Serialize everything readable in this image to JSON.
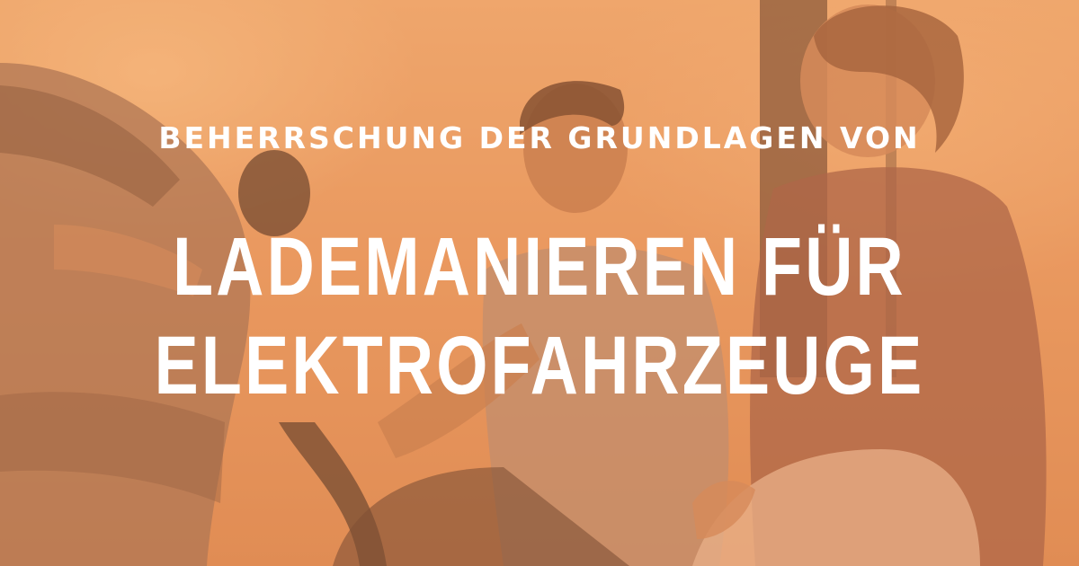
{
  "banner": {
    "subtitle": "BEHERRSCHUNG DER GRUNDLAGEN VON",
    "title_line_1": "LADEMANIEREN FÜR",
    "title_line_2": "ELEKTROFAHRZEUGE",
    "overlay_color": "#EC8E50",
    "text_color": "#FFFFFF"
  }
}
